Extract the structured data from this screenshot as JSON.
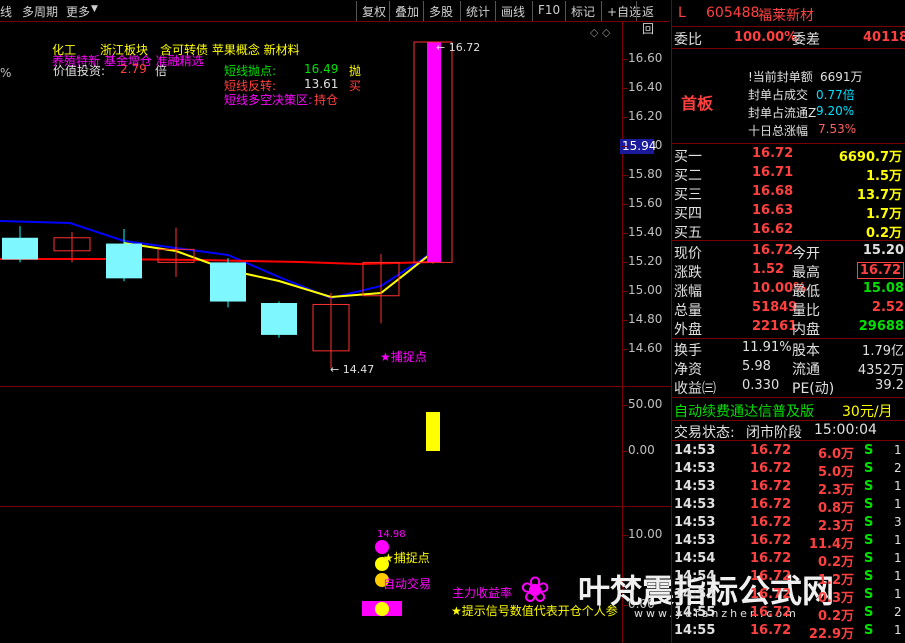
{
  "toolbar": {
    "left_items": [
      "线",
      "多周期",
      "更多"
    ],
    "buttons": [
      "复权",
      "叠加",
      "多股",
      "统计",
      "画线",
      "F10",
      "标记",
      "+自选",
      "返回"
    ]
  },
  "chart_labels": {
    "sector_line": "化工　　浙江板块　含可转债 苹果概念 新材料",
    "sector_line2": "养殖特新 基金增仓 准融精选",
    "value_label": "价值投资:",
    "value_num": "2.79",
    "value_unit": "倍",
    "pct_marker": "%",
    "sig1_label": "短线抛点:",
    "sig1_val": "16.49",
    "sig1_tag": "抛",
    "sig2_label": "短线反转:",
    "sig2_val": "13.61",
    "sig2_tag": "买",
    "sig3_label": "短线多空决策区:",
    "sig3_tag": "持仓",
    "high_label": "16.72",
    "low_label": "14.47",
    "catch_point": "★捕捉点",
    "ind_top_val": "14.98",
    "catch_point2": "捕捉点",
    "auto_trade": "自动交易",
    "main_profit": "主力收益率",
    "tip": "★提示信号数值代表开仓个人参",
    "watermark": "叶梵震指标公式网",
    "watermark_url": "www.yefanzhen.com",
    "price_tag": "15.94"
  },
  "chart_data": {
    "type": "candlestick",
    "y_ticks": [
      "16.60",
      "16.40",
      "16.20",
      "16.00",
      "15.80",
      "15.60",
      "15.40",
      "15.20",
      "15.00",
      "14.80",
      "14.60"
    ],
    "sub1_ticks": [
      "50.00",
      "0.00"
    ],
    "sub2_ticks": [
      "10.00",
      "0.00"
    ],
    "candles": [
      {
        "open": 15.37,
        "close": 15.22,
        "high": 15.45,
        "low": 15.2,
        "up": false
      },
      {
        "open": 15.28,
        "close": 15.37,
        "high": 15.41,
        "low": 15.2,
        "up": true
      },
      {
        "open": 15.33,
        "close": 15.09,
        "high": 15.43,
        "low": 15.07,
        "up": false
      },
      {
        "open": 15.2,
        "close": 15.29,
        "high": 15.44,
        "low": 15.1,
        "up": true
      },
      {
        "open": 15.2,
        "close": 14.93,
        "high": 15.23,
        "low": 14.89,
        "up": false
      },
      {
        "open": 14.92,
        "close": 14.7,
        "high": 14.93,
        "low": 14.68,
        "up": false
      },
      {
        "open": 14.59,
        "close": 14.91,
        "high": 14.99,
        "low": 14.47,
        "up": true
      },
      {
        "open": 14.97,
        "close": 15.2,
        "high": 15.26,
        "low": 14.78,
        "up": true
      },
      {
        "open": 15.2,
        "close": 16.72,
        "high": 16.72,
        "low": 15.19,
        "up": true
      }
    ],
    "last_bar_color": "#ff00ff"
  },
  "quote": {
    "code_prefix": "L",
    "code": "605488",
    "name": "福莱新材",
    "wb_label": "委比",
    "wb_val": "100.00%",
    "wc_label": "委差",
    "wc_val": "40118",
    "board_tag": "首板",
    "seal_info": [
      {
        "label": "!当前封单额",
        "value": "6691万"
      },
      {
        "label": "封单占成交",
        "value": "0.77倍"
      },
      {
        "label": "封单占流通Z",
        "value": "9.20%"
      },
      {
        "label": "十日总涨幅",
        "value": "7.53%"
      }
    ],
    "bids": [
      {
        "label": "买一",
        "price": "16.72",
        "vol": "6690.7万"
      },
      {
        "label": "买二",
        "price": "16.71",
        "vol": "1.5万"
      },
      {
        "label": "买三",
        "price": "16.68",
        "vol": "13.7万"
      },
      {
        "label": "买四",
        "price": "16.63",
        "vol": "1.7万"
      },
      {
        "label": "买五",
        "price": "16.62",
        "vol": "0.2万"
      }
    ],
    "stats": [
      {
        "l1": "现价",
        "v1": "16.72",
        "l2": "今开",
        "v2": "15.20"
      },
      {
        "l1": "涨跌",
        "v1": "1.52",
        "l2": "最高",
        "v2": "16.72"
      },
      {
        "l1": "涨幅",
        "v1": "10.00%",
        "l2": "最低",
        "v2": "15.08"
      },
      {
        "l1": "总量",
        "v1": "51849",
        "l2": "量比",
        "v2": "2.52"
      },
      {
        "l1": "外盘",
        "v1": "22161",
        "l2": "内盘",
        "v2": "29688"
      }
    ],
    "stats2": [
      {
        "l1": "换手",
        "v1": "11.91%",
        "l2": "股本",
        "v2": "1.79亿"
      },
      {
        "l1": "净资",
        "v1": "5.98",
        "l2": "流通",
        "v2": "4352万"
      },
      {
        "l1": "收益㈢",
        "v1": "0.330",
        "l2": "PE(动)",
        "v2": "39.2"
      }
    ],
    "promo": "自动续费通达信普及版",
    "promo_price": "30元/月",
    "status_label": "交易状态:",
    "status_val": "闭市阶段",
    "status_time": "15:00:04",
    "ticks": [
      {
        "t": "14:53",
        "p": "16.72",
        "v": "6.0万",
        "s": "S",
        "n": "1"
      },
      {
        "t": "14:53",
        "p": "16.72",
        "v": "5.0万",
        "s": "S",
        "n": "2"
      },
      {
        "t": "14:53",
        "p": "16.72",
        "v": "2.3万",
        "s": "S",
        "n": "1"
      },
      {
        "t": "14:53",
        "p": "16.72",
        "v": "0.8万",
        "s": "S",
        "n": "1"
      },
      {
        "t": "14:53",
        "p": "16.72",
        "v": "2.3万",
        "s": "S",
        "n": "3"
      },
      {
        "t": "14:53",
        "p": "16.72",
        "v": "11.4万",
        "s": "S",
        "n": "1"
      },
      {
        "t": "14:54",
        "p": "16.72",
        "v": "0.2万",
        "s": "S",
        "n": "1"
      },
      {
        "t": "14:54",
        "p": "16.72",
        "v": "1.2万",
        "s": "S",
        "n": "1"
      },
      {
        "t": "14:55",
        "p": "16.72",
        "v": "0.3万",
        "s": "S",
        "n": "1"
      },
      {
        "t": "14:55",
        "p": "16.72",
        "v": "0.2万",
        "s": "S",
        "n": "2"
      },
      {
        "t": "14:55",
        "p": "16.72",
        "v": "22.9万",
        "s": "S",
        "n": "1"
      }
    ]
  }
}
